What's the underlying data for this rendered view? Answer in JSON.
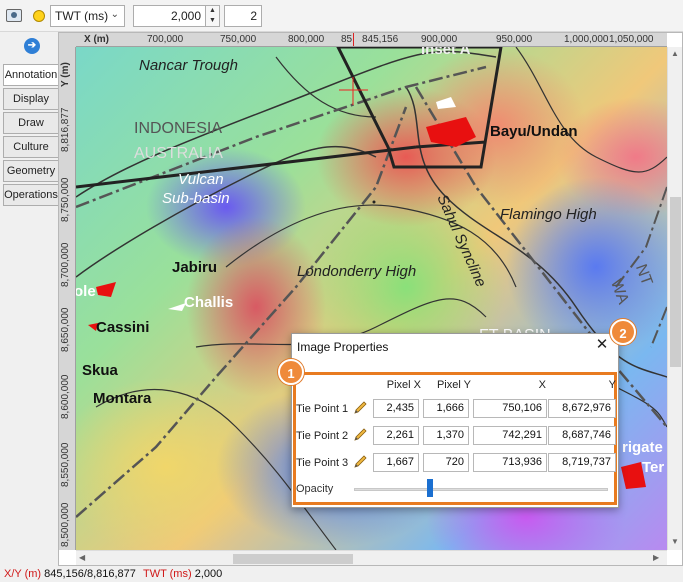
{
  "toolbar": {
    "domain_select": "TWT (ms)",
    "depth_value": "2,000",
    "step_value": "2"
  },
  "side_tabs": [
    {
      "label": "Annotation",
      "active": true
    },
    {
      "label": "Display",
      "active": false
    },
    {
      "label": "Draw",
      "active": false
    },
    {
      "label": "Culture",
      "active": false
    },
    {
      "label": "Geometry",
      "active": false
    },
    {
      "label": "Operations",
      "active": false
    }
  ],
  "ruler": {
    "x_title": "X (m)",
    "y_title": "Y (m)",
    "x_ticks": [
      "700,000",
      "750,000",
      "800,000",
      "85",
      "900,000",
      "950,000",
      "1,000,000",
      "1,050,000"
    ],
    "x_cursor": "845,156",
    "y_ticks": [
      "8,816,877",
      "8,750,000",
      "8,700,000",
      "8,650,000",
      "8,600,000",
      "8,550,000",
      "8,500,000"
    ]
  },
  "map_labels": {
    "nancar_trough": "Nancar Trough",
    "inset_a": "Inset A",
    "indonesia": "INDONESIA",
    "australia": "AUSTRALIA",
    "bayu_undan": "Bayu/Undan",
    "vulcan": "Vulcan",
    "sub_basin": "Sub-basin",
    "flamingo_high": "Flamingo High",
    "sahul_syncline": "Sahul Syncline",
    "jabiru": "Jabiru",
    "londonderry_high": "Londonderry High",
    "challis": "Challis",
    "cassini": "Cassini",
    "ole": "ole",
    "skua": "Skua",
    "montara": "Montara",
    "ft_basin": "FT BASIN",
    "nt": "NT",
    "wa": "WA",
    "frigate": "rigate",
    "ter": "Ter"
  },
  "dialog": {
    "title": "Image Properties",
    "headers": {
      "pixel_x": "Pixel X",
      "pixel_y": "Pixel Y",
      "x": "X",
      "y": "Y"
    },
    "tie_points": [
      {
        "label": "Tie Point 1",
        "pixel_x": "2,435",
        "pixel_y": "1,666",
        "x": "750,106",
        "y": "8,672,976"
      },
      {
        "label": "Tie Point 2",
        "pixel_x": "2,261",
        "pixel_y": "1,370",
        "x": "742,291",
        "y": "8,687,746"
      },
      {
        "label": "Tie Point 3",
        "pixel_x": "1,667",
        "pixel_y": "720",
        "x": "713,936",
        "y": "8,719,737"
      }
    ],
    "opacity_label": "Opacity",
    "opacity_fraction": 0.3
  },
  "badges": {
    "one": "1",
    "two": "2"
  },
  "status": {
    "xy_label": "X/Y (m)",
    "xy_value": "845,156/8,816,877",
    "twt_label": "TWT (ms)",
    "twt_value": "2,000"
  },
  "colors": {
    "accent": "#e87b20",
    "slider": "#1a6fd0",
    "cursor": "#d22222"
  }
}
